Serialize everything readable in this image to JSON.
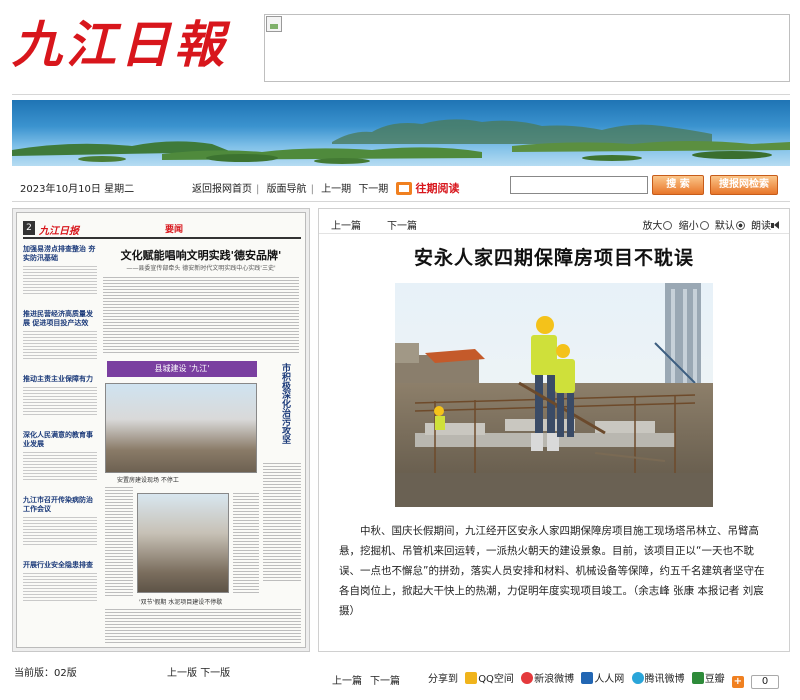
{
  "header": {
    "logo_text": "九江日報"
  },
  "nav": {
    "date": "2023年10月10日 星期二",
    "links": [
      "返回报网首页",
      "版面导航",
      "上一期",
      "下一期"
    ],
    "past_label": "往期阅读",
    "search_placeholder": "",
    "search_button": "搜 索",
    "advanced_search_button": "搜报网检索"
  },
  "paper_thumbnail": {
    "page_no": "2",
    "logo": "九江日报",
    "tag": "要闻",
    "headline": "文化赋能唱响文明实践'德安品牌'",
    "subhead": "——县委宣传部牵头 德安新时代文明实践中心实践'三史'",
    "sidebar_items": [
      "加强易涝点排查整治 夯实防汛基础",
      "推进民营经济高质量发展 促进项目投产达效",
      "推动主责主业保障有力",
      "深化人民满意的教育事业发展",
      "九江市召开传染病防治工作会议",
      "开展行业安全隐患排查"
    ],
    "color_banner": "县城建设 '九江'",
    "vertical_headline": "市积极深化治污攻坚",
    "caption_a": "安置房建设现场 不停工",
    "caption_b": "'双节'假期 水泥项目建设不停歇"
  },
  "left_footer": {
    "current_label": "当前版：",
    "current_page": "02版",
    "prev": "上一版",
    "next": "下一版"
  },
  "article_tools": {
    "prev": "上一篇",
    "next": "下一篇",
    "zoom_in": "放大",
    "zoom_out": "缩小",
    "default": "默认",
    "read": "朗读"
  },
  "article": {
    "title": "安永人家四期保障房项目不耽误",
    "body": "中秋、国庆长假期间，九江经开区安永人家四期保障房项目施工现场塔吊林立、吊臂高悬，挖掘机、吊管机来回运转，一派热火朝天的建设景象。目前，该项目正以“一天也不耽误、一点也不懈怠”的拼劲，落实人员安排和材料、机械设备等保障，约五千名建筑者坚守在各自岗位上，掀起大干快上的热潮，力促明年度实现项目竣工。（余志峰 张康 本报记者 刘宸 摄）"
  },
  "article_footer": {
    "prev": "上一篇",
    "next": "下一篇",
    "share_label": "分享到",
    "share_targets": [
      "QQ空间",
      "新浪微博",
      "人人网",
      "腾讯微博",
      "豆瓣"
    ],
    "share_count": "0"
  },
  "colors": {
    "brand_red": "#d8161c",
    "accent_orange": "#f08020"
  }
}
